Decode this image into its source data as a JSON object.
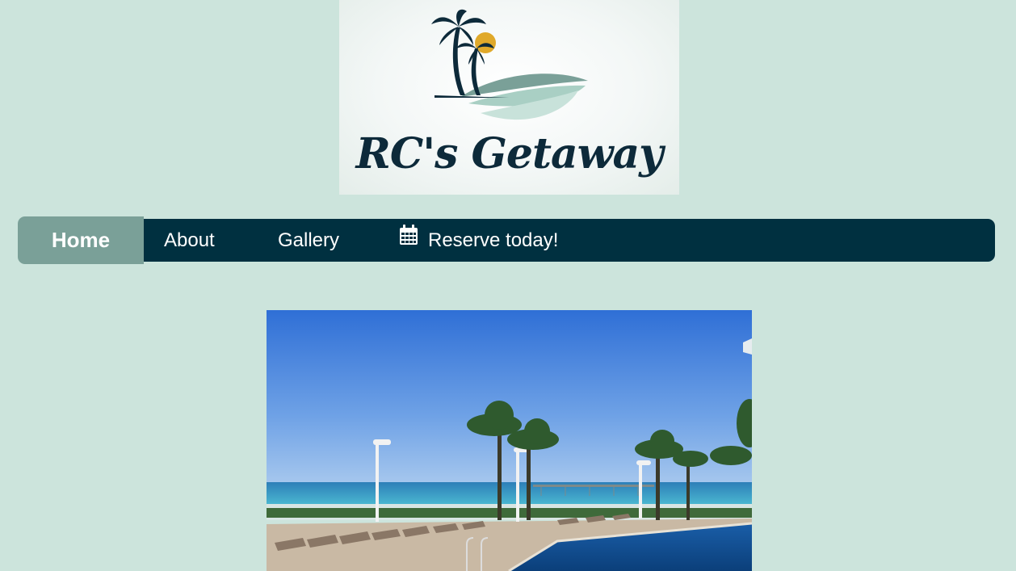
{
  "logo": {
    "text": "RC's Getaway",
    "icon": "palm-tree-sun-wave-logo"
  },
  "nav": {
    "items": [
      {
        "label": "Home",
        "active": true
      },
      {
        "label": "About"
      },
      {
        "label": "Gallery"
      },
      {
        "label": "Reserve today!",
        "icon": "calendar-icon"
      }
    ]
  },
  "hero": {
    "description": "beach-pool-palm-trees-photo"
  },
  "colors": {
    "background": "#cce4dc",
    "nav": "#003040",
    "nav_active": "#7aa098",
    "logo_dark": "#0d2a3a",
    "sun": "#e0a92a"
  }
}
